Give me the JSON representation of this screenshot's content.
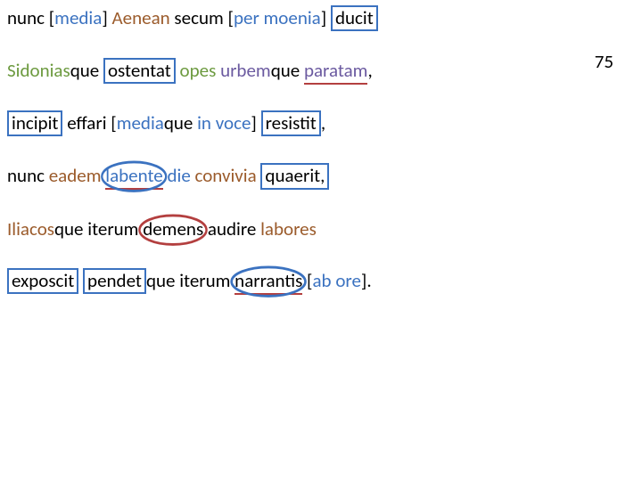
{
  "linenum": "75",
  "l1": {
    "t1": "nunc [",
    "t2": "media",
    "t3": "] ",
    "t4": "Aenean",
    "t5": " secum [",
    "t6": "per moenia",
    "t7": "] ",
    "t8": "ducit"
  },
  "l2": {
    "t1": "Sidonias",
    "t2": "que ",
    "t3": "ostentat",
    "t4": " ",
    "t5": "opes",
    "t6": " ",
    "t7": "urbem",
    "t8": "que ",
    "t9": "paratam",
    "t10": ","
  },
  "l3": {
    "t1": "incipit",
    "t2": " effari [",
    "t3": "media",
    "t4": "que ",
    "t5": "in voce",
    "t6": "] ",
    "t7": "resistit",
    "t8": ","
  },
  "l4": {
    "t1": "nunc ",
    "t2": "eadem",
    "t3": " ",
    "t4": "labente",
    "t5": " ",
    "t6": "die",
    "t7": " ",
    "t8": "convivia",
    "t9": " ",
    "t10": "quaerit,"
  },
  "l5": {
    "t1": "Iliacos",
    "t2": "que iterum ",
    "t3": "demens",
    "t4": " audire ",
    "t5": "labores"
  },
  "l6": {
    "t1": "exposcit",
    "t2": " ",
    "t3": "pendet",
    "t4": "que iterum ",
    "t5": "narrantis",
    "t6": " [",
    "t7": "ab ore",
    "t8": "]."
  }
}
